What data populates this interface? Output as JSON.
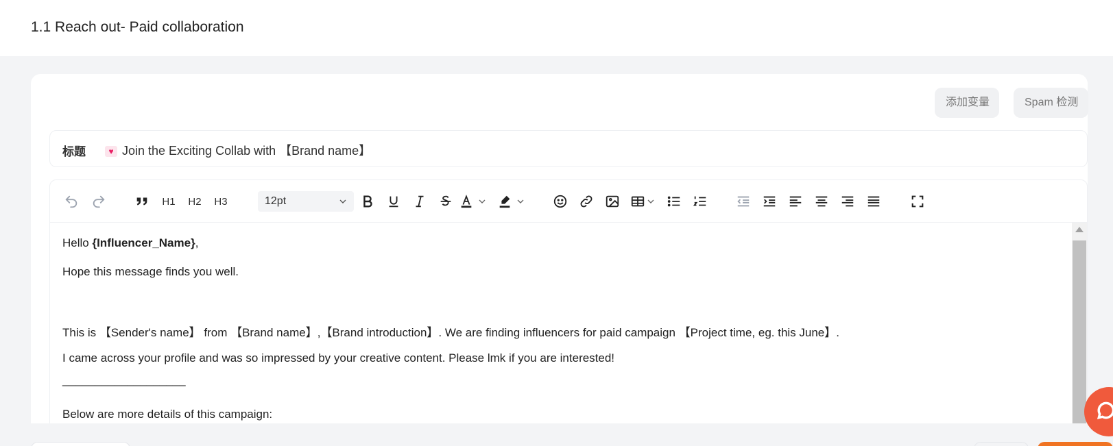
{
  "page": {
    "title": "1.1 Reach out- Paid collaboration"
  },
  "actions": {
    "add_variable": "添加变量",
    "spam_check": "Spam 检测"
  },
  "subject": {
    "label": "标题",
    "emoji": "💌",
    "value": "Join the Exciting Collab with 【Brand name】"
  },
  "toolbar": {
    "h1": "H1",
    "h2": "H2",
    "h3": "H3",
    "font_size": "12pt",
    "icons": [
      "undo-icon",
      "redo-icon",
      "blockquote-icon",
      "heading-1",
      "heading-2",
      "heading-3",
      "font-size-select",
      "bold-icon",
      "underline-icon",
      "italic-icon",
      "strikethrough-icon",
      "text-color-icon",
      "highlight-color-icon",
      "emoji-icon",
      "link-icon",
      "image-icon",
      "table-icon",
      "bullet-list-icon",
      "numbered-list-icon",
      "outdent-icon",
      "indent-icon",
      "align-left-icon",
      "align-center-icon",
      "align-right-icon",
      "align-justify-icon",
      "fullscreen-icon"
    ]
  },
  "body": {
    "greeting_prefix": "Hello ",
    "greeting_variable": "{Influencer_Name}",
    "greeting_suffix": ",",
    "line2": "Hope this message finds you well.",
    "line3": "This is 【Sender's name】 from 【Brand name】,【Brand introduction】. We are finding influencers for paid campaign 【Project time, eg. this June】.",
    "line4": "I came across your profile and was so impressed by your creative content. Please lmk if you are interested!",
    "divider": "___________________",
    "line5": "Below are more details of this campaign:"
  },
  "colors": {
    "accent_orange": "#f07322",
    "chat_bubble": "#f05a3c"
  }
}
